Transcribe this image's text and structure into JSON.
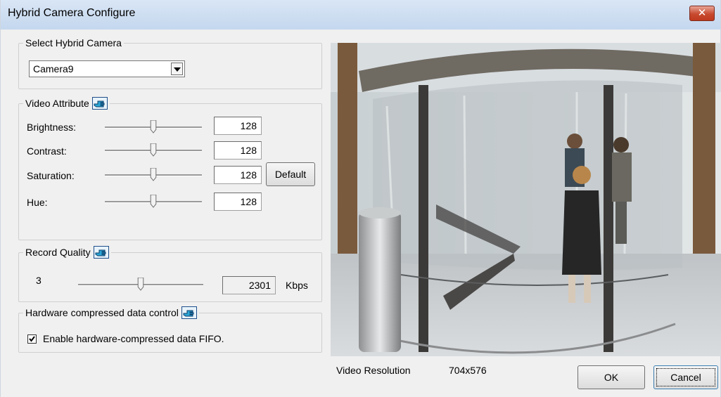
{
  "window": {
    "title": "Hybrid Camera Configure",
    "close_glyph": "✕"
  },
  "select_camera": {
    "legend": "Select Hybrid Camera",
    "selected": "Camera9"
  },
  "video_attribute": {
    "legend": "Video Attribute",
    "rows": [
      {
        "label": "Brightness:",
        "value": "128",
        "level": 0.5
      },
      {
        "label": "Contrast:",
        "value": "128",
        "level": 0.5
      },
      {
        "label": "Saturation:",
        "value": "128",
        "level": 0.5
      },
      {
        "label": "Hue:",
        "value": "128",
        "level": 0.5
      }
    ],
    "default_label": "Default"
  },
  "record_quality": {
    "legend": "Record Quality",
    "level_label": "3",
    "level": 0.5,
    "bitrate": "2301",
    "unit": "Kbps"
  },
  "hardware": {
    "legend": "Hardware compressed data control",
    "checkbox_label": "Enable hardware-compressed data FIFO.",
    "checked": true
  },
  "footer": {
    "resolution_label": "Video Resolution",
    "resolution_value": "704x576",
    "ok_label": "OK",
    "cancel_label": "Cancel"
  },
  "icons": [
    "hand-pointer-icon",
    "chevron-down-icon",
    "close-icon",
    "checkmark-icon"
  ],
  "colors": {
    "titlebar": "#c4d7ee",
    "close_button": "#c74a2f",
    "dialog_bg": "#f0f0f0",
    "help_icon_bg": "#e8f3fb"
  }
}
